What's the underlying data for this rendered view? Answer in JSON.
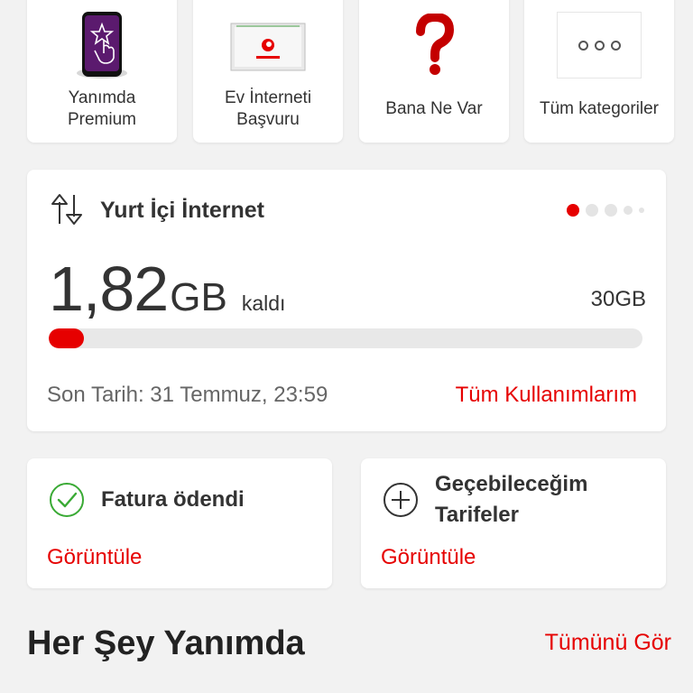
{
  "categories": [
    {
      "label_line1": "Yanımda",
      "label_line2": "Premium",
      "icon": "premium-phone-icon"
    },
    {
      "label_line1": "Ev İnterneti",
      "label_line2": "Başvuru",
      "icon": "vodafone-modem-icon"
    },
    {
      "label_line1": "Bana Ne Var",
      "label_line2": "",
      "icon": "red-question-mark-icon"
    },
    {
      "label_line1": "Tüm kategoriler",
      "label_line2": "",
      "icon": "more-dots-icon"
    }
  ],
  "usage": {
    "title": "Yurt İçi İnternet",
    "remaining_value": "1,82",
    "remaining_unit": "GB",
    "remaining_suffix": "kaldı",
    "total": "30GB",
    "used_fraction": 0.06,
    "deadline": "Son Tarih: 31 Temmuz, 23:59",
    "all_usage_link": "Tüm Kullanımlarım",
    "carousel_active_index": 0,
    "carousel_count": 5
  },
  "bill": {
    "title": "Fatura ödendi",
    "link": "Görüntüle",
    "icon": "check-circle-icon"
  },
  "tariffs": {
    "title_line1": "Geçebileceğim",
    "title_line2": "Tarifeler",
    "link": "Görüntüle",
    "icon": "plus-circle-icon"
  },
  "section": {
    "title": "Her Şey Yanımda",
    "see_all": "Tümünü Gör"
  },
  "colors": {
    "accent": "#e60000",
    "check": "#3aaa35",
    "background": "#f2f2f2"
  }
}
